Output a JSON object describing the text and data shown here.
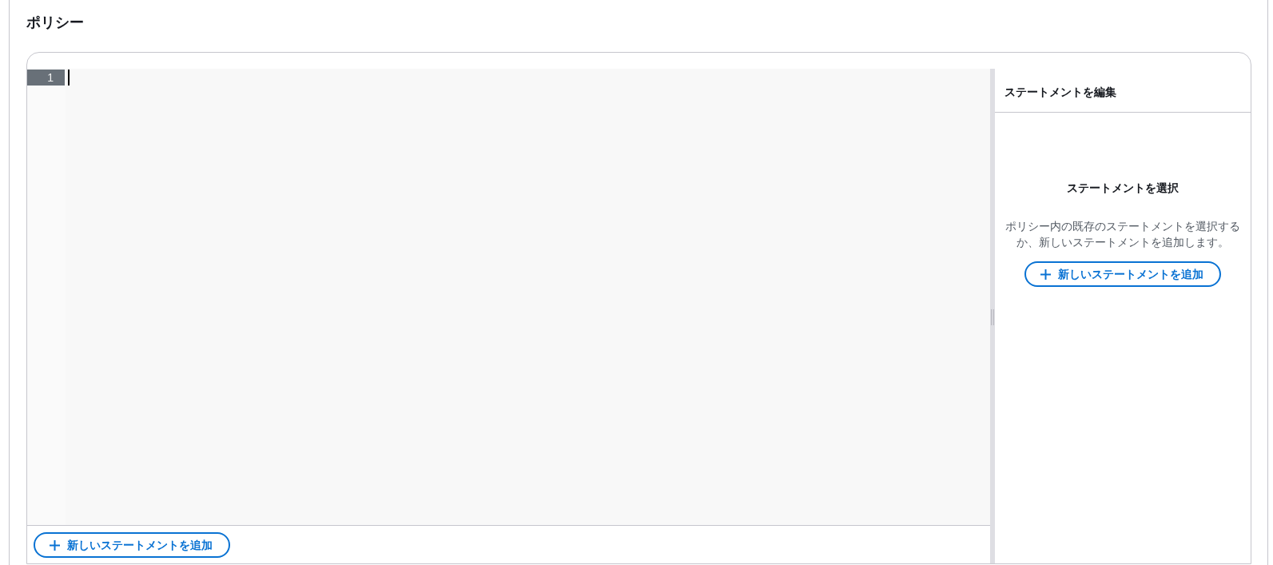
{
  "section": {
    "title": "ポリシー"
  },
  "editor": {
    "lines": [
      {
        "number": "1",
        "active": true
      }
    ],
    "cursor": true
  },
  "footer": {
    "add_button": {
      "label": "新しいステートメントを追加"
    }
  },
  "statement_panel": {
    "title": "ステートメントを編集",
    "empty_state": {
      "heading": "ステートメントを選択",
      "description": "ポリシー内の既存のステートメントを選択するか、新しいステートメントを追加します。",
      "button": {
        "label": "新しいステートメントを追加"
      }
    }
  }
}
